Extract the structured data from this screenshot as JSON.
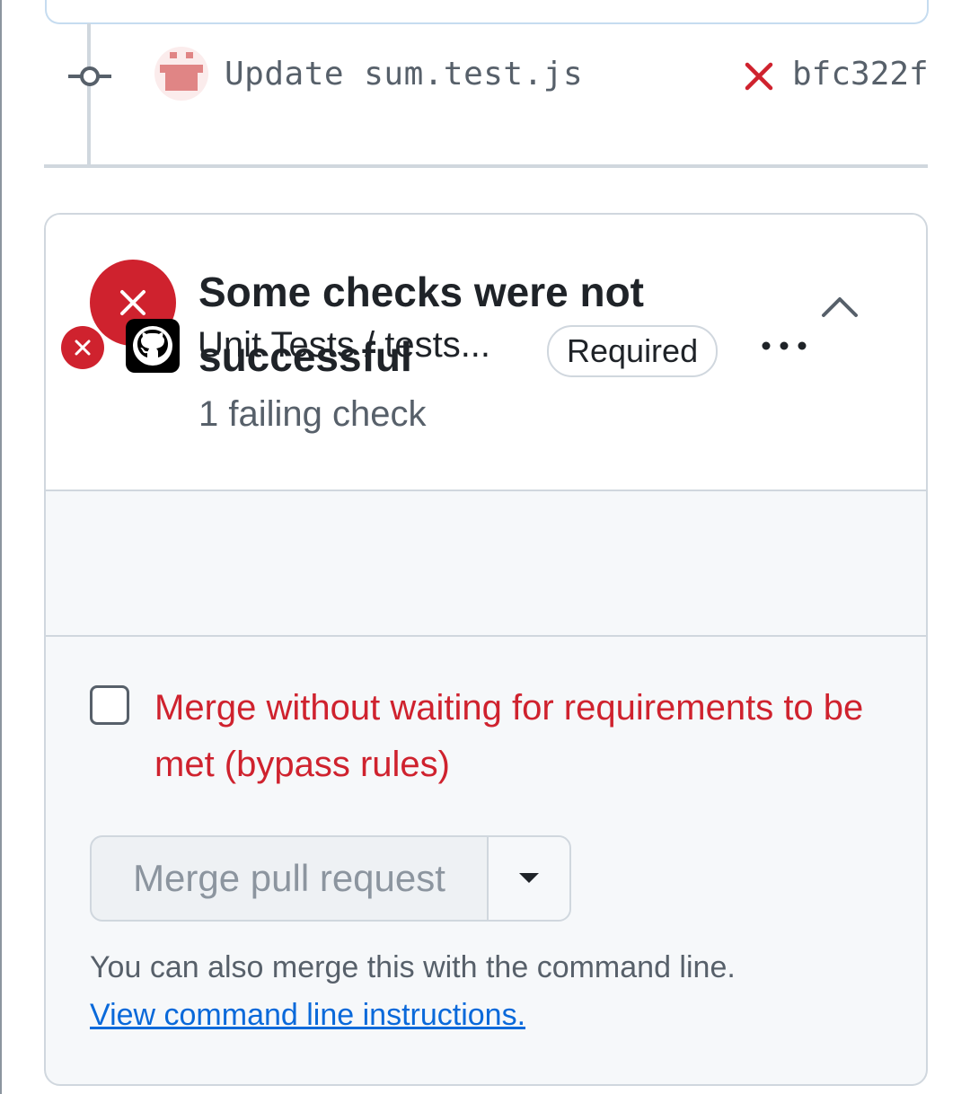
{
  "timeline": {
    "commit_message": "Update sum.test.js",
    "commit_sha": "bfc322f",
    "commit_status": "failed",
    "node_icon": "git-commit-icon",
    "avatar_icon": "identicon-avatar"
  },
  "checks": {
    "title": "Some checks were not successful",
    "subtitle": "1 failing check",
    "status_icon": "x-circle-icon",
    "collapse_icon": "chevron-up-icon",
    "items": [
      {
        "name": "Unit Tests / tests...",
        "badge": "Required",
        "status": "failure",
        "provider_icon": "github-icon",
        "more_icon": "kebab-horizontal-icon"
      }
    ]
  },
  "merge": {
    "bypass_label": "Merge without waiting for requirements to be met (bypass rules)",
    "bypass_checked": false,
    "button_label": "Merge pull request",
    "dropdown_icon": "triangle-down-icon",
    "cli_text": "You can also merge this with the command line.",
    "cli_link": "View command line instructions."
  },
  "colors": {
    "danger": "#cf222e",
    "link": "#0969da",
    "muted": "#57606a",
    "border": "#d0d7de"
  }
}
